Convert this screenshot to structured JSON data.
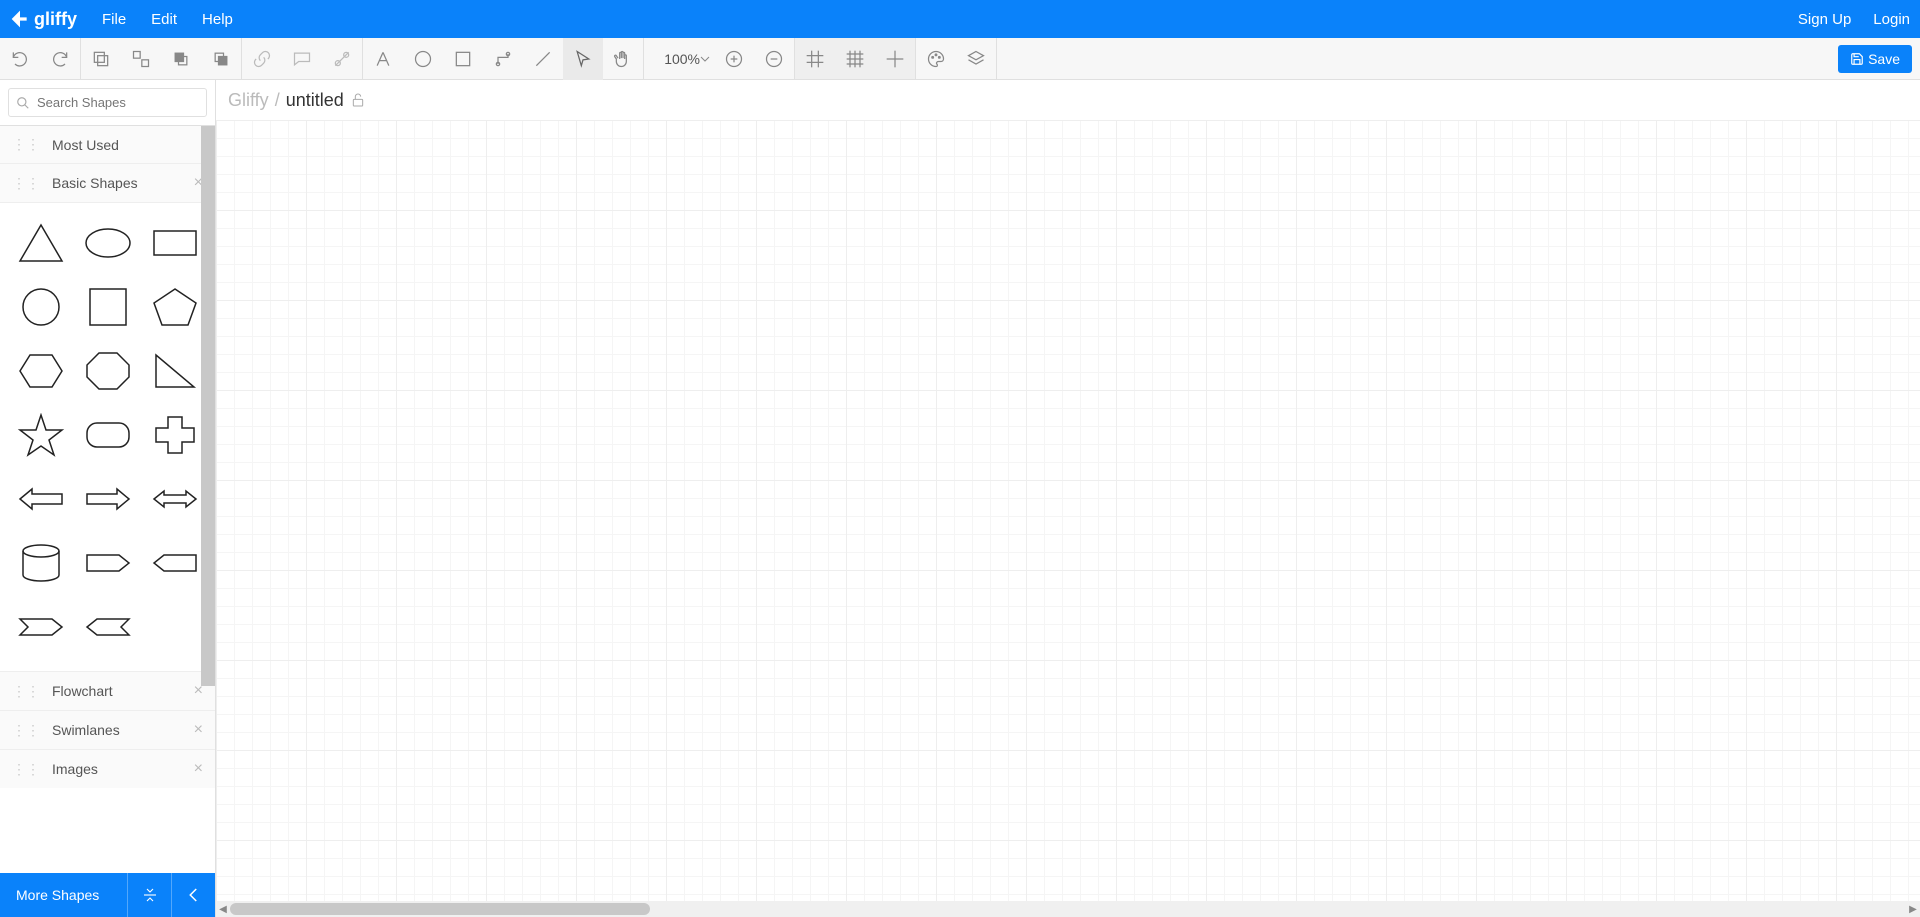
{
  "brand": "gliffy",
  "menu": {
    "file": "File",
    "edit": "Edit",
    "help": "Help"
  },
  "auth": {
    "signup": "Sign Up",
    "login": "Login"
  },
  "toolbar": {
    "zoom": "100%",
    "save": "Save"
  },
  "search": {
    "placeholder": "Search Shapes"
  },
  "panels": {
    "most_used": "Most Used",
    "basic_shapes": "Basic Shapes",
    "flowchart": "Flowchart",
    "swimlanes": "Swimlanes",
    "images": "Images"
  },
  "basic_shapes_items": [
    "triangle",
    "ellipse",
    "rectangle",
    "circle",
    "square",
    "pentagon",
    "hexagon",
    "octagon",
    "right-triangle",
    "star",
    "rounded-rectangle",
    "plus",
    "arrow-left",
    "arrow-right",
    "arrow-both",
    "cylinder",
    "tag-right",
    "tag-left",
    "chevron-right",
    "chevron-left"
  ],
  "footer": {
    "more_shapes": "More Shapes"
  },
  "breadcrumb": {
    "root": "Gliffy",
    "sep": "/",
    "title": "untitled"
  }
}
